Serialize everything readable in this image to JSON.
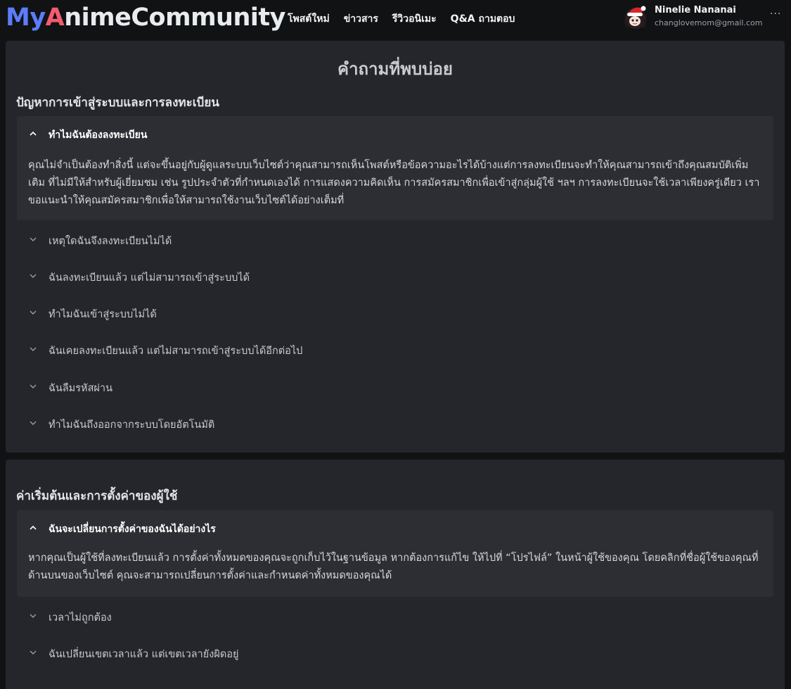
{
  "logo": {
    "part1": "My",
    "part2": "A",
    "part3": "nimeCommunity"
  },
  "nav": [
    {
      "label": "โพสต์ใหม่"
    },
    {
      "label": "ข่าวสาร"
    },
    {
      "label": "รีวิวอนิเมะ"
    },
    {
      "label": "Q&A ถามตอบ"
    }
  ],
  "user": {
    "name": "Ninelie Nananai",
    "email": "changlovemom@gmail.com",
    "more_icon": "more-horizontal-icon"
  },
  "page_title": "คำถามที่พบบ่อย",
  "sections": [
    {
      "title": "ปัญหาการเข้าสู่ระบบและการลงทะเบียน",
      "open_question": "ทำไมฉันต้องลงทะเบียน",
      "open_answer": "คุณไม่จำเป็นต้องทำสิ่งนี้ แต่จะขึ้นอยู่กับผู้ดูแลระบบเว็บไซต์ว่าคุณสามารถเห็นโพสต์หรือข้อความอะไรได้บ้างแต่การลงทะเบียนจะทำให้คุณสามารถเข้าถึงคุณสมบัติเพิ่มเติม ที่ไม่มีให้สำหรับผู้เยี่ยมชม เช่น รูปประจำตัวที่กำหนดเองได้ การแสดงความคิดเห็น การสมัครสมาชิกเพื่อเข้าสู่กลุ่มผู้ใช้ ฯลฯ การลงทะเบียนจะใช้เวลาเพียงครู่เดียว เราขอแนะนำให้คุณสมัครสมาชิกเพื่อให้สามารถใช้งานเว็บไซต์ได้อย่างเต็มที่",
      "questions": [
        "เหตุใดฉันจึงลงทะเบียนไม่ได้",
        "ฉันลงทะเบียนแล้ว แต่ไม่สามารถเข้าสู่ระบบได้",
        "ทำไมฉันเข้าสู่ระบบไม่ได้",
        "ฉันเคยลงทะเบียนแล้ว แต่ไม่สามารถเข้าสู่ระบบได้อีกต่อไป",
        "ฉันลืมรหัสผ่าน",
        "ทำไมฉันถึงออกจากระบบโดยอัตโนมัติ"
      ]
    },
    {
      "title": "ค่าเริ่มต้นและการตั้งค่าของผู้ใช้",
      "open_question": "ฉันจะเปลี่ยนการตั้งค่าของฉันได้อย่างไร",
      "open_answer": "หากคุณเป็นผู้ใช้ที่ลงทะเบียนแล้ว การตั้งค่าทั้งหมดของคุณจะถูกเก็บไว้ในฐานข้อมูล หากต้องการแก้ไข ให้ไปที่ “โปรไฟล์” ในหน้าผู้ใช้ของคุณ โดยคลิกที่ชื่อผู้ใช้ของคุณที่ด้านบนของเว็บไซต์ คุณจะสามารถเปลี่ยนการตั้งค่าและกำหนดค่าทั้งหมดของคุณได้",
      "questions": [
        "เวลาไม่ถูกต้อง",
        "ฉันเปลี่ยนเขตเวลาแล้ว แต่เขตเวลายังผิดอยู่"
      ]
    }
  ],
  "colors": {
    "background": "#111214",
    "panel": "#25262b",
    "open_item": "#2c2e33",
    "logo_blue": "#5c7cfa",
    "logo_red": "#f25c6e"
  }
}
